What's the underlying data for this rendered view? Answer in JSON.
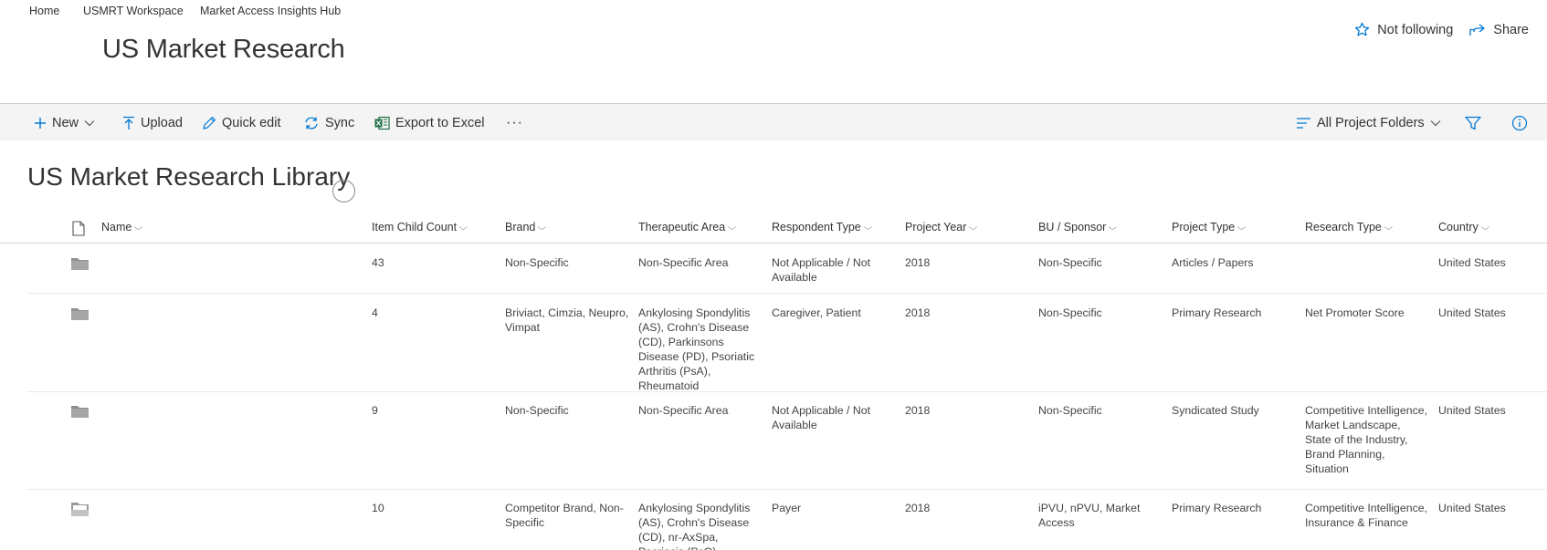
{
  "breadcrumb": [
    "Home",
    "USMRT Workspace",
    "Market Access Insights Hub"
  ],
  "site_title": "US Market Research",
  "actions": {
    "follow": "Not following",
    "share": "Share"
  },
  "commands": {
    "new": "New",
    "upload": "Upload",
    "quick_edit": "Quick edit",
    "sync": "Sync",
    "export": "Export to Excel",
    "more": "···",
    "view": "All Project Folders"
  },
  "library_title": "US Market Research Library",
  "columns": [
    "Name",
    "Item Child Count",
    "Brand",
    "Therapeutic Area",
    "Respondent Type",
    "Project Year",
    "BU / Sponsor",
    "Project Type",
    "Research Type",
    "Country"
  ],
  "rows": [
    {
      "name": "",
      "count": "43",
      "brand": "Non-Specific",
      "therapeutic": "Non-Specific Area",
      "respondent": "Not Applicable / Not Available",
      "year": "2018",
      "bu": "Non-Specific",
      "project_type": "Articles / Papers",
      "research_type": "",
      "country": "United States",
      "icon": "folder-icon"
    },
    {
      "name": "",
      "count": "4",
      "brand": "Briviact, Cimzia, Neupro, Vimpat",
      "therapeutic": "Ankylosing Spondylitis (AS), Crohn's Disease (CD), Parkinsons Disease (PD), Psoriatic Arthritis (PsA), Rheumatoid",
      "respondent": "Caregiver, Patient",
      "year": "2018",
      "bu": "Non-Specific",
      "project_type": "Primary Research",
      "research_type": "Net Promoter Score",
      "country": "United States",
      "icon": "folder-icon"
    },
    {
      "name": "",
      "count": "9",
      "brand": "Non-Specific",
      "therapeutic": "Non-Specific Area",
      "respondent": "Not Applicable / Not Available",
      "year": "2018",
      "bu": "Non-Specific",
      "project_type": "Syndicated Study",
      "research_type": "Competitive Intelligence, Market Landscape, State of the Industry, Brand Planning, Situation",
      "country": "United States",
      "icon": "folder-icon"
    },
    {
      "name": "",
      "count": "10",
      "brand": "Competitor Brand, Non-Specific",
      "therapeutic": "Ankylosing Spondylitis (AS), Crohn's Disease (CD), nr-AxSpa, Psoriasis (PsO), Psoriatic Arthritis",
      "respondent": "Payer",
      "year": "2018",
      "bu": "iPVU, nPVU, Market Access",
      "project_type": "Primary Research",
      "research_type": "Competitive Intelligence, Insurance & Finance",
      "country": "United States",
      "icon": "folder-open-icon"
    }
  ],
  "colors": {
    "accent": "#0078d4",
    "excel": "#1e7145",
    "command_bar": "#f4f4f4"
  }
}
